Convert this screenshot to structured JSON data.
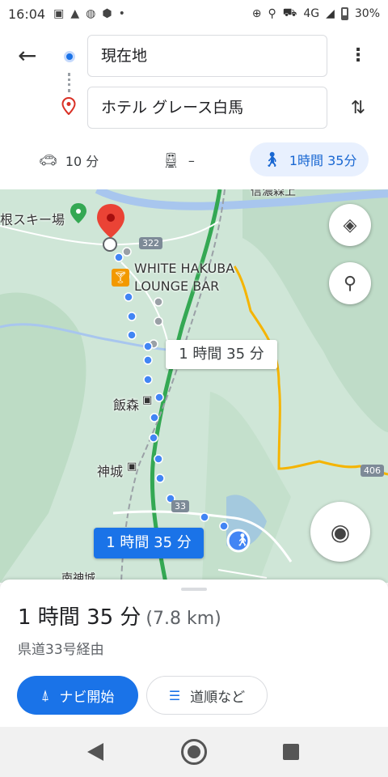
{
  "status_bar": {
    "time": "16:04",
    "network": "4G",
    "battery": "30%"
  },
  "search": {
    "origin": "現在地",
    "destination": "ホテル グレース白馬"
  },
  "modes": {
    "car": "10 分",
    "train": "–",
    "walk": "1時間 35分"
  },
  "map": {
    "labels": {
      "ski_area": "根スキー場",
      "bar_line1": "WHITE HAKUBA",
      "bar_line2": "LOUNGE BAR",
      "iimori": "飯森",
      "kamishiro": "神城",
      "minamikamishiro": "南神城",
      "top_label": "信濃森上"
    },
    "roads": {
      "r322": "322",
      "r33": "33",
      "r406": "406"
    },
    "callout_time": "1 時間 35 分",
    "callout_time_selected": "1 時間 35 分"
  },
  "sheet": {
    "duration": "1 時間 35 分",
    "distance": "(7.8 km)",
    "via": "県道33号経由",
    "start_label": "ナビ開始",
    "steps_label": "道順など"
  },
  "colors": {
    "accent": "#1a73e8",
    "route_dot": "#4285f4",
    "map_bg": "#cfe6d7",
    "river": "#a8c6ee",
    "highway": "#34a853",
    "yellow_road": "#f5b400"
  }
}
